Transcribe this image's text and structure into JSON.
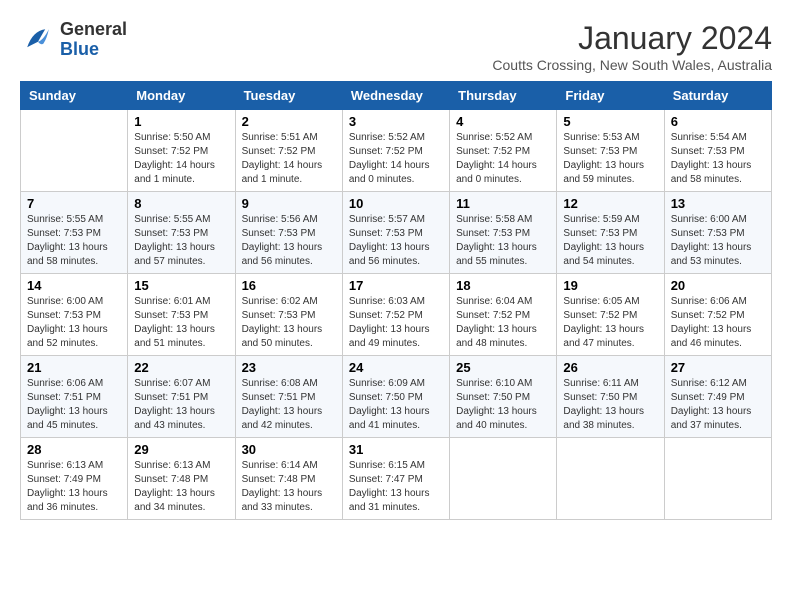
{
  "header": {
    "logo_line1": "General",
    "logo_line2": "Blue",
    "month_title": "January 2024",
    "location": "Coutts Crossing, New South Wales, Australia"
  },
  "columns": [
    "Sunday",
    "Monday",
    "Tuesday",
    "Wednesday",
    "Thursday",
    "Friday",
    "Saturday"
  ],
  "weeks": [
    [
      {
        "day": "",
        "info": ""
      },
      {
        "day": "1",
        "info": "Sunrise: 5:50 AM\nSunset: 7:52 PM\nDaylight: 14 hours\nand 1 minute."
      },
      {
        "day": "2",
        "info": "Sunrise: 5:51 AM\nSunset: 7:52 PM\nDaylight: 14 hours\nand 1 minute."
      },
      {
        "day": "3",
        "info": "Sunrise: 5:52 AM\nSunset: 7:52 PM\nDaylight: 14 hours\nand 0 minutes."
      },
      {
        "day": "4",
        "info": "Sunrise: 5:52 AM\nSunset: 7:52 PM\nDaylight: 14 hours\nand 0 minutes."
      },
      {
        "day": "5",
        "info": "Sunrise: 5:53 AM\nSunset: 7:53 PM\nDaylight: 13 hours\nand 59 minutes."
      },
      {
        "day": "6",
        "info": "Sunrise: 5:54 AM\nSunset: 7:53 PM\nDaylight: 13 hours\nand 58 minutes."
      }
    ],
    [
      {
        "day": "7",
        "info": "Sunrise: 5:55 AM\nSunset: 7:53 PM\nDaylight: 13 hours\nand 58 minutes."
      },
      {
        "day": "8",
        "info": "Sunrise: 5:55 AM\nSunset: 7:53 PM\nDaylight: 13 hours\nand 57 minutes."
      },
      {
        "day": "9",
        "info": "Sunrise: 5:56 AM\nSunset: 7:53 PM\nDaylight: 13 hours\nand 56 minutes."
      },
      {
        "day": "10",
        "info": "Sunrise: 5:57 AM\nSunset: 7:53 PM\nDaylight: 13 hours\nand 56 minutes."
      },
      {
        "day": "11",
        "info": "Sunrise: 5:58 AM\nSunset: 7:53 PM\nDaylight: 13 hours\nand 55 minutes."
      },
      {
        "day": "12",
        "info": "Sunrise: 5:59 AM\nSunset: 7:53 PM\nDaylight: 13 hours\nand 54 minutes."
      },
      {
        "day": "13",
        "info": "Sunrise: 6:00 AM\nSunset: 7:53 PM\nDaylight: 13 hours\nand 53 minutes."
      }
    ],
    [
      {
        "day": "14",
        "info": "Sunrise: 6:00 AM\nSunset: 7:53 PM\nDaylight: 13 hours\nand 52 minutes."
      },
      {
        "day": "15",
        "info": "Sunrise: 6:01 AM\nSunset: 7:53 PM\nDaylight: 13 hours\nand 51 minutes."
      },
      {
        "day": "16",
        "info": "Sunrise: 6:02 AM\nSunset: 7:53 PM\nDaylight: 13 hours\nand 50 minutes."
      },
      {
        "day": "17",
        "info": "Sunrise: 6:03 AM\nSunset: 7:52 PM\nDaylight: 13 hours\nand 49 minutes."
      },
      {
        "day": "18",
        "info": "Sunrise: 6:04 AM\nSunset: 7:52 PM\nDaylight: 13 hours\nand 48 minutes."
      },
      {
        "day": "19",
        "info": "Sunrise: 6:05 AM\nSunset: 7:52 PM\nDaylight: 13 hours\nand 47 minutes."
      },
      {
        "day": "20",
        "info": "Sunrise: 6:06 AM\nSunset: 7:52 PM\nDaylight: 13 hours\nand 46 minutes."
      }
    ],
    [
      {
        "day": "21",
        "info": "Sunrise: 6:06 AM\nSunset: 7:51 PM\nDaylight: 13 hours\nand 45 minutes."
      },
      {
        "day": "22",
        "info": "Sunrise: 6:07 AM\nSunset: 7:51 PM\nDaylight: 13 hours\nand 43 minutes."
      },
      {
        "day": "23",
        "info": "Sunrise: 6:08 AM\nSunset: 7:51 PM\nDaylight: 13 hours\nand 42 minutes."
      },
      {
        "day": "24",
        "info": "Sunrise: 6:09 AM\nSunset: 7:50 PM\nDaylight: 13 hours\nand 41 minutes."
      },
      {
        "day": "25",
        "info": "Sunrise: 6:10 AM\nSunset: 7:50 PM\nDaylight: 13 hours\nand 40 minutes."
      },
      {
        "day": "26",
        "info": "Sunrise: 6:11 AM\nSunset: 7:50 PM\nDaylight: 13 hours\nand 38 minutes."
      },
      {
        "day": "27",
        "info": "Sunrise: 6:12 AM\nSunset: 7:49 PM\nDaylight: 13 hours\nand 37 minutes."
      }
    ],
    [
      {
        "day": "28",
        "info": "Sunrise: 6:13 AM\nSunset: 7:49 PM\nDaylight: 13 hours\nand 36 minutes."
      },
      {
        "day": "29",
        "info": "Sunrise: 6:13 AM\nSunset: 7:48 PM\nDaylight: 13 hours\nand 34 minutes."
      },
      {
        "day": "30",
        "info": "Sunrise: 6:14 AM\nSunset: 7:48 PM\nDaylight: 13 hours\nand 33 minutes."
      },
      {
        "day": "31",
        "info": "Sunrise: 6:15 AM\nSunset: 7:47 PM\nDaylight: 13 hours\nand 31 minutes."
      },
      {
        "day": "",
        "info": ""
      },
      {
        "day": "",
        "info": ""
      },
      {
        "day": "",
        "info": ""
      }
    ]
  ]
}
